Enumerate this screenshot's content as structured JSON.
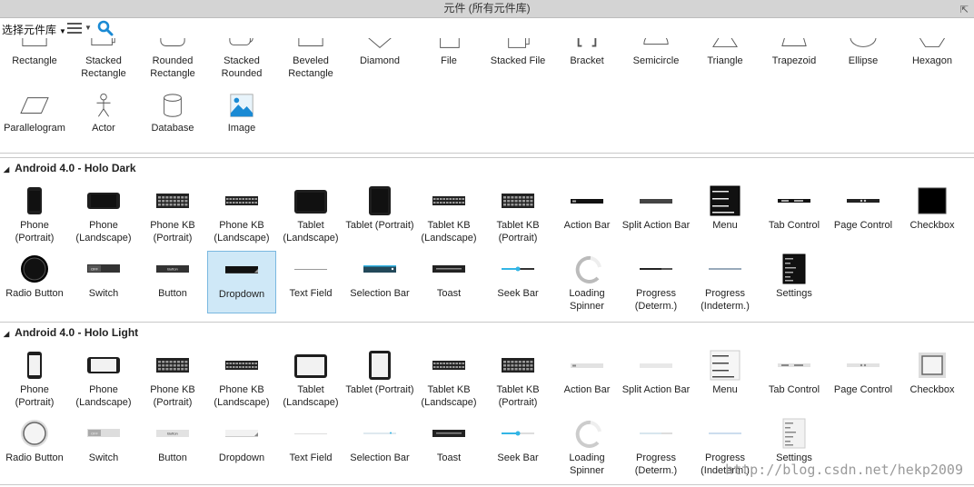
{
  "window": {
    "title": "元件 (所有元件库)"
  },
  "toolbar": {
    "library_select": "选择元件库"
  },
  "flowchart": [
    {
      "label": "Rectangle",
      "icon": "rectangle-icon"
    },
    {
      "label": "Stacked Rectangle",
      "icon": "stacked-rectangle-icon"
    },
    {
      "label": "Rounded Rectangle",
      "icon": "rounded-rectangle-icon"
    },
    {
      "label": "Stacked Rounded",
      "icon": "stacked-rounded-icon"
    },
    {
      "label": "Beveled Rectangle",
      "icon": "beveled-rectangle-icon"
    },
    {
      "label": "Diamond",
      "icon": "diamond-icon"
    },
    {
      "label": "File",
      "icon": "file-icon"
    },
    {
      "label": "Stacked File",
      "icon": "stacked-file-icon"
    },
    {
      "label": "Bracket",
      "icon": "bracket-icon"
    },
    {
      "label": "Semicircle",
      "icon": "semicircle-icon"
    },
    {
      "label": "Triangle",
      "icon": "triangle-icon"
    },
    {
      "label": "Trapezoid",
      "icon": "trapezoid-icon"
    },
    {
      "label": "Ellipse",
      "icon": "ellipse-icon"
    },
    {
      "label": "Hexagon",
      "icon": "hexagon-icon"
    },
    {
      "label": "Parallelogram",
      "icon": "parallelogram-icon"
    },
    {
      "label": "Actor",
      "icon": "actor-icon"
    },
    {
      "label": "Database",
      "icon": "database-icon"
    },
    {
      "label": "Image",
      "icon": "image-icon"
    }
  ],
  "sections": [
    {
      "title": "Android 4.0 - Holo Dark",
      "theme": "dark",
      "items": [
        {
          "label": "Phone (Portrait)",
          "icon": "phone-portrait-icon"
        },
        {
          "label": "Phone (Landscape)",
          "icon": "phone-landscape-icon"
        },
        {
          "label": "Phone KB (Portrait)",
          "icon": "keyboard-icon"
        },
        {
          "label": "Phone KB (Landscape)",
          "icon": "keyboard-wide-icon"
        },
        {
          "label": "Tablet (Landscape)",
          "icon": "tablet-landscape-icon"
        },
        {
          "label": "Tablet (Portrait)",
          "icon": "tablet-portrait-icon"
        },
        {
          "label": "Tablet KB (Landscape)",
          "icon": "keyboard-wide-icon"
        },
        {
          "label": "Tablet KB (Portrait)",
          "icon": "keyboard-icon"
        },
        {
          "label": "Action Bar",
          "icon": "bar-icon"
        },
        {
          "label": "Split Action Bar",
          "icon": "split-bar-icon"
        },
        {
          "label": "Menu",
          "icon": "menu-icon"
        },
        {
          "label": "Tab Control",
          "icon": "tab-control-icon"
        },
        {
          "label": "Page Control",
          "icon": "page-control-icon"
        },
        {
          "label": "Checkbox",
          "icon": "checkbox-icon"
        },
        {
          "label": "Radio Button",
          "icon": "radio-icon"
        },
        {
          "label": "Switch",
          "icon": "switch-icon"
        },
        {
          "label": "Button",
          "icon": "button-icon"
        },
        {
          "label": "Dropdown",
          "icon": "dropdown-icon",
          "selected": true
        },
        {
          "label": "Text Field",
          "icon": "text-field-icon"
        },
        {
          "label": "Selection Bar",
          "icon": "selection-bar-icon"
        },
        {
          "label": "Toast",
          "icon": "toast-icon"
        },
        {
          "label": "Seek Bar",
          "icon": "seek-bar-icon"
        },
        {
          "label": "Loading Spinner",
          "icon": "spinner-icon"
        },
        {
          "label": "Progress (Determ.)",
          "icon": "progress-icon"
        },
        {
          "label": "Progress (Indeterm.)",
          "icon": "progress-indeterminate-icon"
        },
        {
          "label": "Settings",
          "icon": "settings-icon"
        }
      ]
    },
    {
      "title": "Android 4.0 - Holo Light",
      "theme": "light",
      "items": [
        {
          "label": "Phone (Portrait)",
          "icon": "phone-portrait-icon"
        },
        {
          "label": "Phone (Landscape)",
          "icon": "phone-landscape-icon"
        },
        {
          "label": "Phone KB (Portrait)",
          "icon": "keyboard-icon"
        },
        {
          "label": "Phone KB (Landscape)",
          "icon": "keyboard-wide-icon"
        },
        {
          "label": "Tablet (Landscape)",
          "icon": "tablet-landscape-icon"
        },
        {
          "label": "Tablet (Portrait)",
          "icon": "tablet-portrait-icon"
        },
        {
          "label": "Tablet KB (Landscape)",
          "icon": "keyboard-wide-icon"
        },
        {
          "label": "Tablet KB (Portrait)",
          "icon": "keyboard-icon"
        },
        {
          "label": "Action Bar",
          "icon": "bar-icon"
        },
        {
          "label": "Split Action Bar",
          "icon": "split-bar-icon"
        },
        {
          "label": "Menu",
          "icon": "menu-icon"
        },
        {
          "label": "Tab Control",
          "icon": "tab-control-icon"
        },
        {
          "label": "Page Control",
          "icon": "page-control-icon"
        },
        {
          "label": "Checkbox",
          "icon": "checkbox-icon"
        },
        {
          "label": "Radio Button",
          "icon": "radio-icon"
        },
        {
          "label": "Switch",
          "icon": "switch-icon"
        },
        {
          "label": "Button",
          "icon": "button-icon"
        },
        {
          "label": "Dropdown",
          "icon": "dropdown-icon"
        },
        {
          "label": "Text Field",
          "icon": "text-field-icon"
        },
        {
          "label": "Selection Bar",
          "icon": "selection-bar-icon"
        },
        {
          "label": "Toast",
          "icon": "toast-icon"
        },
        {
          "label": "Seek Bar",
          "icon": "seek-bar-icon"
        },
        {
          "label": "Loading Spinner",
          "icon": "spinner-icon"
        },
        {
          "label": "Progress (Determ.)",
          "icon": "progress-icon"
        },
        {
          "label": "Progress (Indeterm.)",
          "icon": "progress-indeterminate-icon"
        },
        {
          "label": "Settings",
          "icon": "settings-icon"
        }
      ]
    }
  ],
  "widget_text": {
    "switch": "OFF",
    "button": "Button"
  },
  "watermark": "http://blog.csdn.net/hekp2009",
  "colors": {
    "selected_bg": "#cfe8f7",
    "selected_border": "#7ab8e0",
    "accent": "#33b5e5",
    "dark_widget": "#111111"
  }
}
